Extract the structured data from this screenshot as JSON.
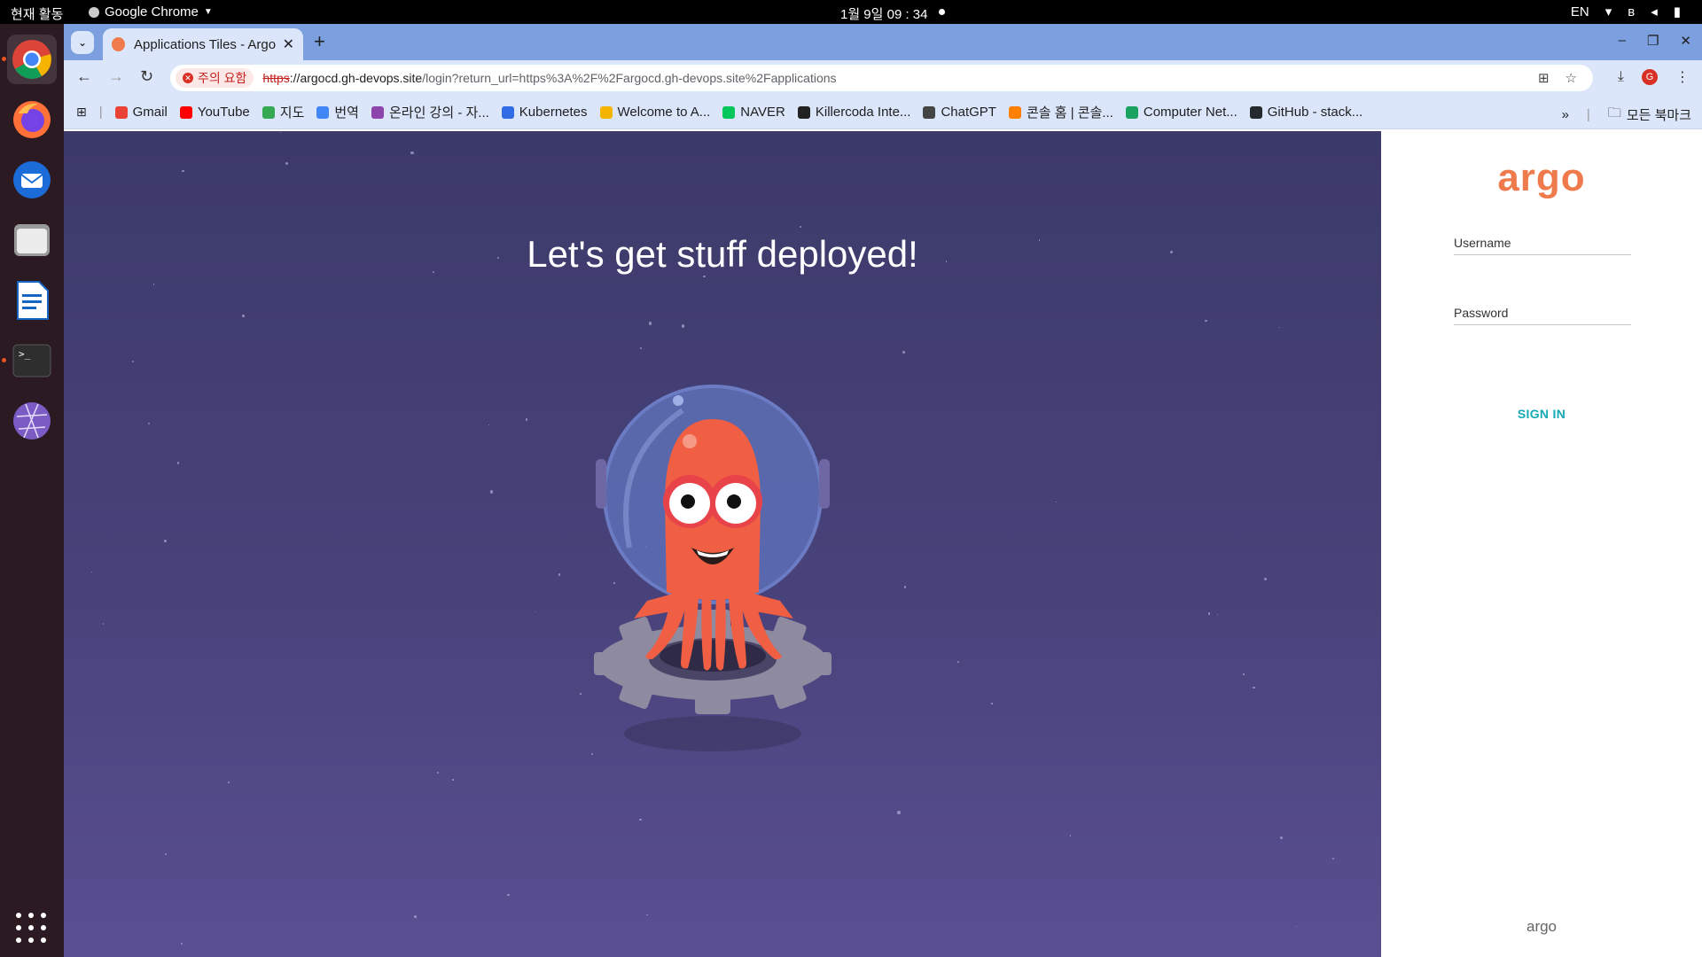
{
  "system": {
    "activities": "현재 활동",
    "app_menu": "Google Chrome",
    "clock": "1월 9일  09 : 34",
    "lang": "EN"
  },
  "browser": {
    "tab_title": "Applications Tiles - Argo CD",
    "security_chip": "주의 요함",
    "url_scheme": "https",
    "url_host": "://argocd.gh-devops.site",
    "url_path": "/login?return_url=https%3A%2F%2Fargocd.gh-devops.site%2Fapplications",
    "profile_initial": "G",
    "bookmarks": [
      {
        "label": "Gmail",
        "color": "#ea4335"
      },
      {
        "label": "YouTube",
        "color": "#ff0000"
      },
      {
        "label": "지도",
        "color": "#34a853"
      },
      {
        "label": "번역",
        "color": "#4285f4"
      },
      {
        "label": "온라인 강의 - 자...",
        "color": "#8e44ad"
      },
      {
        "label": "Kubernetes",
        "color": "#326ce5"
      },
      {
        "label": "Welcome to A...",
        "color": "#f4b400"
      },
      {
        "label": "NAVER",
        "color": "#03c75a"
      },
      {
        "label": "Killercoda Inte...",
        "color": "#222222"
      },
      {
        "label": "ChatGPT",
        "color": "#444444"
      },
      {
        "label": "콘솔 홈 | 콘솔...",
        "color": "#ff7f00"
      },
      {
        "label": "Computer Net...",
        "color": "#1aa260"
      },
      {
        "label": "GitHub - stack...",
        "color": "#24292e"
      }
    ],
    "all_bookmarks": "모든 북마크"
  },
  "page": {
    "hero_title": "Let's get stuff deployed!",
    "logo": "argo",
    "username_label": "Username",
    "password_label": "Password",
    "signin_label": "SIGN IN",
    "footer_logo": "argo"
  },
  "colors": {
    "argo_orange": "#ef7b4d",
    "signin_teal": "#14a9b3",
    "hero_bg": "#48427a"
  }
}
